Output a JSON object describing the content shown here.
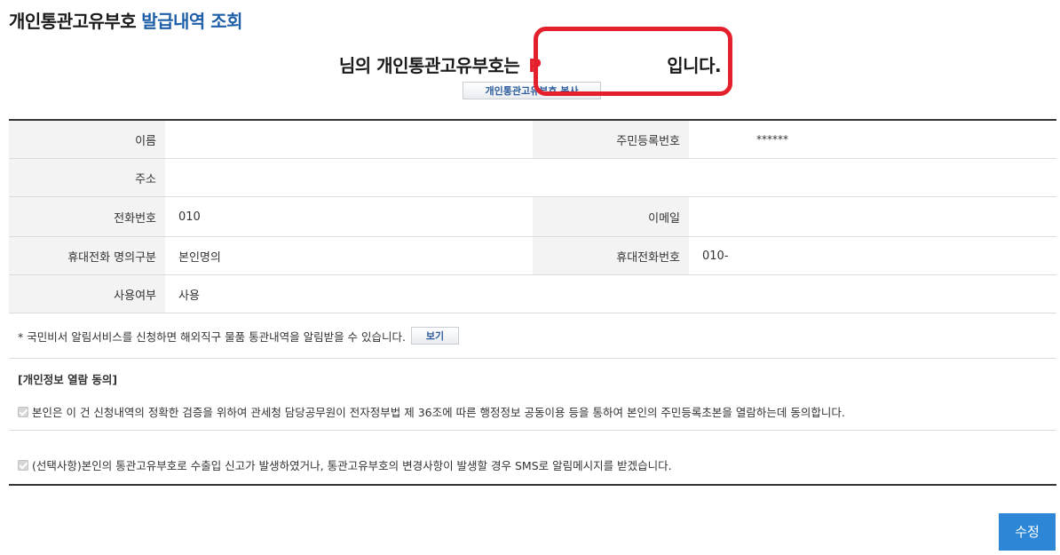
{
  "title": {
    "main": "개인통관고유부호",
    "accent": "발급내역 조회"
  },
  "headline": {
    "prefix": "님의 개인통관고유부호는",
    "code": "P",
    "suffix": "입니다.",
    "copy_button": "개인통관고유부호 복사"
  },
  "info": {
    "name_label": "이름",
    "name_value": "",
    "rrn_label": "주민등록번호",
    "rrn_value": "******",
    "address_label": "주소",
    "address_value": "",
    "phone_label": "전화번호",
    "phone_value": "010",
    "email_label": "이메일",
    "email_value": "",
    "owner_label": "휴대전화 명의구분",
    "owner_value": "본인명의",
    "mobile_label": "휴대전화번호",
    "mobile_value": "010-",
    "usage_label": "사용여부",
    "usage_value": "사용"
  },
  "notice": {
    "text": "* 국민비서 알림서비스를 신청하면 해외직구 물품 통관내역을 알림받을 수 있습니다.",
    "view_button": "보기"
  },
  "consent": {
    "title": "[개인정보 열람 동의]",
    "item1": "본인은 이 건 신청내역의 정확한 검증을 위하여 관세청 담당공무원이 전자정부법 제 36조에 따른 행정정보 공동이용 등을 통하여 본인의 주민등록초본을 열람하는데 동의합니다.",
    "item2": "(선택사항)본인의 통관고유부호로 수출입 신고가 발생하였거나, 통관고유부호의 변경사항이 발생할 경우 SMS로 알림메시지를 받겠습니다."
  },
  "actions": {
    "submit": "수정"
  },
  "colors": {
    "accent": "#1f5fa8",
    "code_red": "#e3202b",
    "button_blue": "#2d87d6"
  }
}
